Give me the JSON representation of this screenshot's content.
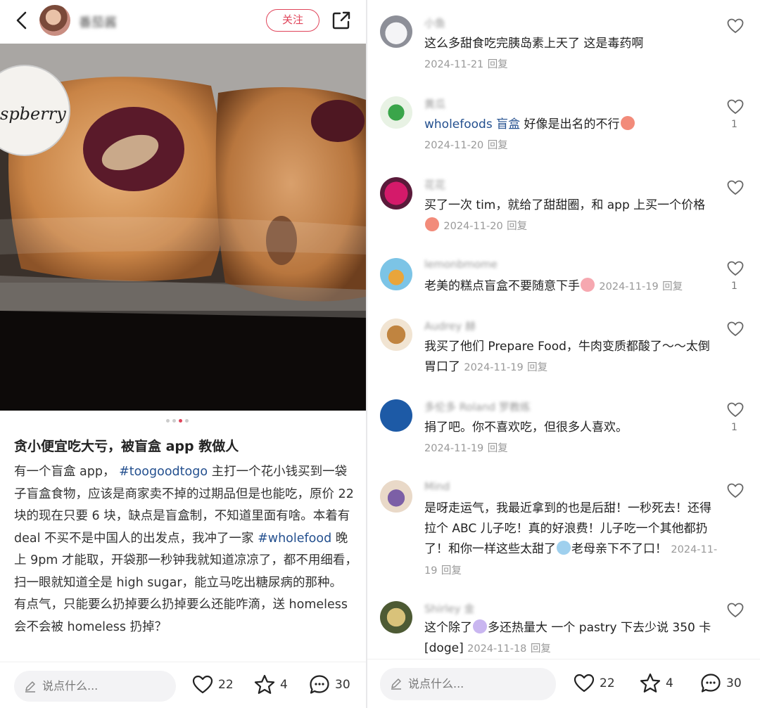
{
  "post": {
    "author_name": "番茄酱",
    "follow_label": "关注",
    "photo_label": "spberry",
    "title": "贪小便宜吃大亏，被盲盒 app 教做人",
    "body_1": "有一个盲盒 app， ",
    "tag_1": "#toogoodtogo",
    "body_2": " 主打一个花小钱买到一袋子盲盒食物，应该是商家卖不掉的过期品但是也能吃，原价 22 块的现在只要 6 块，缺点是盲盒制，不知道里面有啥。本着有 deal 不买不是中国人的出发点，我冲了一家 ",
    "tag_2": "#wholefood",
    "body_3": " 晚上 9pm 才能取，开袋那一秒钟我就知道凉凉了，都不用细看，扫一眼就知道全是 high sugar，能立马吃出糖尿病的那种。 有点气，只能要么扔掉要么扔掉要么还能咋滴，送 homeless 会不会被 homeless 扔掉？"
  },
  "bottom_bar": {
    "placeholder": "说点什么...",
    "likes": "22",
    "stars": "4",
    "comments": "30"
  },
  "comments": [
    {
      "name": "小鱼",
      "text": "这么多甜食吃完胰岛素上天了 这是毒药啊",
      "date": "2024-11-21",
      "reply": "回复",
      "likes": ""
    },
    {
      "name": "黄瓜",
      "tag": "wholefoods 盲盒",
      "text": " 好像是出名的不行",
      "date": "2024-11-20",
      "reply": "回复",
      "likes": "1"
    },
    {
      "name": "花花",
      "text": "买了一次 tim，就给了甜甜圈，和 app 上买一个价格",
      "date": "2024-11-20",
      "reply": "回复",
      "likes": ""
    },
    {
      "name": "lemonbmome",
      "text": "老美的糕点盲盒不要随意下手",
      "date": "2024-11-19",
      "reply": "回复",
      "likes": "1"
    },
    {
      "name": "Audrey 赫",
      "text": "我买了他们 Prepare Food，牛肉变质都酸了～～太倒胃口了",
      "date": "2024-11-19",
      "reply": "回复",
      "likes": ""
    },
    {
      "name": "多伦多 Roland 罗教练",
      "text": "捐了吧。你不喜欢吃，但很多人喜欢。",
      "date": "2024-11-19",
      "reply": "回复",
      "likes": "1"
    },
    {
      "name": "Mind",
      "text": "是呀走运气，我最近拿到的也是后甜！一秒死去！还得拉个 ABC 儿子吃！真的好浪费！儿子吃一个其他都扔了！和你一样这些太甜了",
      "text_2": "老母亲下不了口！",
      "date": "2024-11-19",
      "reply": "回复",
      "likes": ""
    },
    {
      "name": "Shirley 金",
      "text": "这个除了",
      "text_2": "多还热量大 一个 pastry 下去少说 350 卡[doge]",
      "date": "2024-11-18",
      "reply": "回复",
      "likes": ""
    }
  ],
  "colors": {
    "accent": "#e0445a",
    "tag": "#24508f",
    "meta": "#999999"
  }
}
